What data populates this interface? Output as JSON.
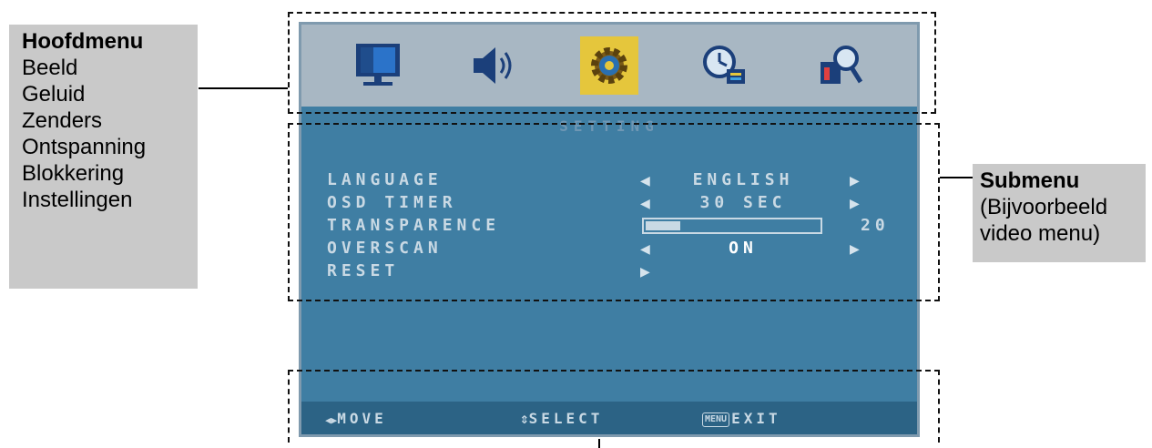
{
  "left_callout": {
    "title": "Hoofdmenu",
    "items": [
      "Beeld",
      "Geluid",
      "Zenders",
      "Ontspanning",
      "Blokkering",
      "Instellingen"
    ]
  },
  "right_callout": {
    "title": "Submenu",
    "lines": [
      "(Bijvoorbeeld",
      "video menu)"
    ]
  },
  "osd": {
    "menu_icons": [
      "monitor-icon",
      "speaker-icon",
      "gear-icon",
      "clock-icon",
      "search-lock-icon"
    ],
    "active_icon": "gear-icon",
    "title": "SETTING",
    "rows": [
      {
        "label": "LANGUAGE",
        "value": "ENGLISH"
      },
      {
        "label": "OSD TIMER",
        "value": "30 SEC"
      },
      {
        "label": "TRANSPARENCE",
        "value": "20",
        "level_fraction": 0.2
      },
      {
        "label": "OVERSCAN",
        "value": "ON"
      },
      {
        "label": "RESET",
        "value": ""
      }
    ],
    "footer": {
      "move": "MOVE",
      "select": "SELECT",
      "menu_badge": "MENU",
      "exit": "EXIT"
    }
  },
  "colors": {
    "osd_background": "#3f7ea3",
    "icon_bar": "#a8b7c3",
    "active_icon_highlight": "#e5c63c",
    "callout_background": "#c9c9c9"
  }
}
